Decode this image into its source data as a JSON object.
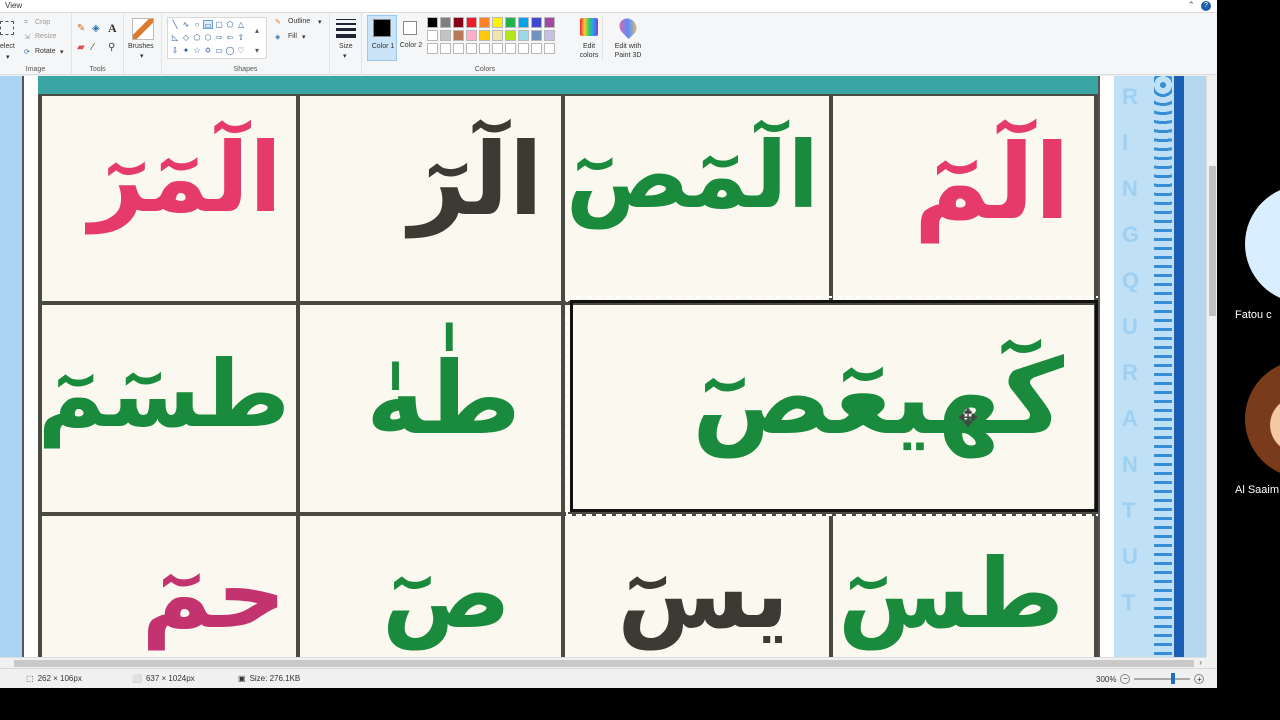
{
  "window": {
    "tab": "View"
  },
  "ribbon": {
    "image": {
      "select_label": "elect",
      "crop_label": "Crop",
      "resize_label": "Resize",
      "rotate_label": "Rotate",
      "group_label": "Image"
    },
    "tools": {
      "group_label": "Tools"
    },
    "brushes": {
      "label": "Brushes"
    },
    "shapes": {
      "outline_label": "Outline",
      "fill_label": "Fill",
      "group_label": "Shapes"
    },
    "size": {
      "label": "Size"
    },
    "color1": {
      "label": "Color 1",
      "value": "#000000"
    },
    "color2": {
      "label": "Color 2",
      "value": "#ffffff"
    },
    "colors": {
      "group_label": "Colors",
      "row1": [
        "#000000",
        "#7f7f7f",
        "#880015",
        "#ed1c24",
        "#ff7f27",
        "#fff200",
        "#22b14c",
        "#00a2e8",
        "#3f48cc",
        "#a349a4"
      ],
      "row2": [
        "#ffffff",
        "#c3c3c3",
        "#b97a57",
        "#ffaec9",
        "#ffc90e",
        "#efe4b0",
        "#b5e61d",
        "#99d9ea",
        "#7092be",
        "#c8bfe7"
      ],
      "row3": [
        "#ffffff",
        "#ffffff",
        "#ffffff",
        "#ffffff",
        "#ffffff",
        "#ffffff",
        "#ffffff",
        "#ffffff",
        "#ffffff",
        "#ffffff"
      ]
    },
    "edit_colors": {
      "label": "Edit colors"
    },
    "paint3d": {
      "label": "Edit with Paint 3D"
    }
  },
  "canvas": {
    "side_letters": [
      "R",
      "I",
      "N",
      "G",
      "Q",
      "U",
      "R",
      "A",
      "N",
      "T",
      "U",
      "T"
    ],
    "cells": [
      {
        "text": "الٓمٓرٓ",
        "color": "#e63a6b"
      },
      {
        "text": "الٓرٓ",
        "color": "#3b3b33"
      },
      {
        "text": "الٓمٓصٓ",
        "color": "#1a8a3c"
      },
      {
        "text": "الٓمٓ",
        "color": "#e63a6b"
      },
      {
        "text": "طسٓمٓ",
        "color": "#1a8a3c"
      },
      {
        "text": "طٰهٰ",
        "color": "#1a8a3c"
      },
      {
        "text": "كٓهيعٓصٓ",
        "color": "#1a8a3c"
      },
      {
        "text": "حمٓ",
        "color": "#c23370"
      },
      {
        "text": "صٓ",
        "color": "#1a8a3c"
      },
      {
        "text": "يسٓ",
        "color": "#3b3b33"
      },
      {
        "text": "طسٓ",
        "color": "#1a8a3c"
      }
    ]
  },
  "status": {
    "selection_size": "262 × 106px",
    "image_size": "637 × 1024px",
    "file_size": "Size: 276.1KB",
    "zoom": "300%",
    "zoom_level": 0.3
  },
  "participants": [
    {
      "name": "Fatou c",
      "avatar_color": "#d9efff"
    },
    {
      "name": "Al Saaim",
      "avatar_color": "#a0522d"
    }
  ]
}
